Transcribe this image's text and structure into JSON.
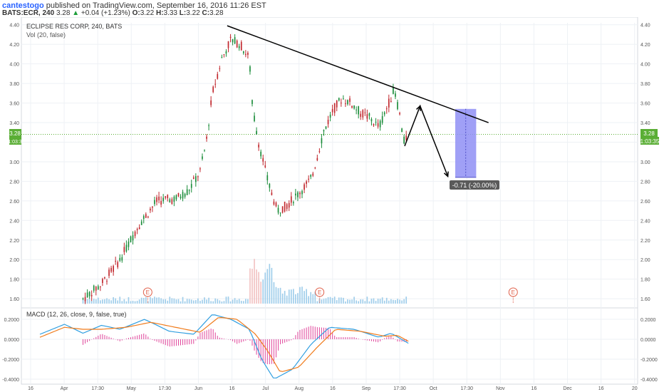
{
  "header": {
    "author": "cantestogo",
    "published_text": " published on TradingView.com, September 16, 2016 11:26 EST",
    "symbol": "BATS:ECR, 240",
    "last": "3.28",
    "change_arrow": "▲",
    "change": "+0.04 (+1.23%)",
    "o_label": "O:",
    "o_value": "3.22",
    "h_label": "H:",
    "h_value": "3.33",
    "l_label": "L:",
    "l_value": "3.22",
    "c_label": "C:",
    "c_value": "3.28"
  },
  "legend": {
    "title": "ECLIPSE RES CORP, 240, BATS",
    "volume": "Vol (20, false)",
    "macd": "MACD (12, 26, close, 9, false, true)"
  },
  "price_badge": {
    "price": "3.28",
    "countdown": "1:03:35",
    "countdown_left": "1:03:3"
  },
  "measure_label": "-0.71 (-20.00%)",
  "earnings_marker": "E",
  "colors": {
    "up": "#1b8c3a",
    "down": "#c1272d",
    "macd_line": "#2f9ee0",
    "signal_line": "#f07b1b",
    "histogram": "#e0449a",
    "volume": "#8fc6e8",
    "volume_red": "#f0b8b8",
    "measure_fill": "#8f8ff5",
    "badge": "#5aae35",
    "grid": "#eef1f5",
    "trendline": "#000000"
  },
  "chart_data": {
    "type": "candlestick",
    "price_axis_ticks": [
      "4.40",
      "4.20",
      "4.00",
      "3.80",
      "3.60",
      "3.40",
      "3.20",
      "3.00",
      "2.80",
      "2.60",
      "2.40",
      "2.20",
      "2.00",
      "1.80",
      "1.60"
    ],
    "macd_axis_ticks": [
      "0.2000",
      "0.0000",
      "-0.2000",
      "-0.4000"
    ],
    "x_tick_labels": [
      "16",
      "Apr",
      "17:30",
      "May",
      "17:30",
      "Jun",
      "16",
      "Jul",
      "Aug",
      "16",
      "Sep",
      "17:30",
      "Oct",
      "17:30",
      "Nov",
      "16",
      "Dec",
      "16",
      "20"
    ],
    "ylim": [
      1.55,
      4.42
    ],
    "macd_ylim": [
      -0.45,
      0.3
    ],
    "last_price": 3.28,
    "trendline": {
      "start": {
        "time": 0.334,
        "price": 4.39
      },
      "end": {
        "time": 0.758,
        "price": 3.4
      }
    },
    "projection_path": [
      {
        "time": 0.622,
        "price": 3.16
      },
      {
        "time": 0.647,
        "price": 3.57
      },
      {
        "time": 0.692,
        "price": 2.85
      }
    ],
    "measure_box": {
      "time_from": 0.704,
      "time_to": 0.738,
      "price_from": 3.54,
      "price_to": 2.84
    },
    "earnings_markers_time": [
      0.205,
      0.484,
      0.798
    ],
    "history_end_time": 0.628,
    "price_anchors": [
      [
        0.1,
        1.6
      ],
      [
        0.13,
        1.75
      ],
      [
        0.16,
        2.0
      ],
      [
        0.19,
        2.35
      ],
      [
        0.22,
        2.6
      ],
      [
        0.25,
        2.62
      ],
      [
        0.27,
        2.7
      ],
      [
        0.29,
        2.9
      ],
      [
        0.3,
        3.2
      ],
      [
        0.31,
        3.7
      ],
      [
        0.325,
        4.05
      ],
      [
        0.34,
        4.25
      ],
      [
        0.355,
        4.2
      ],
      [
        0.37,
        4.05
      ],
      [
        0.375,
        3.55
      ],
      [
        0.385,
        3.2
      ],
      [
        0.4,
        2.8
      ],
      [
        0.415,
        2.5
      ],
      [
        0.43,
        2.55
      ],
      [
        0.45,
        2.68
      ],
      [
        0.47,
        2.82
      ],
      [
        0.48,
        3.05
      ],
      [
        0.49,
        3.3
      ],
      [
        0.505,
        3.52
      ],
      [
        0.52,
        3.65
      ],
      [
        0.535,
        3.6
      ],
      [
        0.55,
        3.5
      ],
      [
        0.565,
        3.45
      ],
      [
        0.58,
        3.35
      ],
      [
        0.595,
        3.58
      ],
      [
        0.605,
        3.74
      ],
      [
        0.615,
        3.45
      ],
      [
        0.62,
        3.2
      ],
      [
        0.628,
        3.28
      ]
    ],
    "macd_anchors": [
      [
        0.03,
        0.05
      ],
      [
        0.07,
        0.15
      ],
      [
        0.1,
        0.06
      ],
      [
        0.13,
        0.14
      ],
      [
        0.16,
        0.1
      ],
      [
        0.2,
        0.2
      ],
      [
        0.24,
        0.08
      ],
      [
        0.28,
        0.05
      ],
      [
        0.31,
        0.25
      ],
      [
        0.34,
        0.2
      ],
      [
        0.37,
        0.1
      ],
      [
        0.39,
        -0.2
      ],
      [
        0.41,
        -0.4
      ],
      [
        0.44,
        -0.3
      ],
      [
        0.47,
        -0.05
      ],
      [
        0.5,
        0.12
      ],
      [
        0.54,
        0.1
      ],
      [
        0.58,
        0.02
      ],
      [
        0.6,
        0.06
      ],
      [
        0.628,
        -0.04
      ]
    ],
    "signal_anchors": [
      [
        0.03,
        0.02
      ],
      [
        0.07,
        0.12
      ],
      [
        0.1,
        0.1
      ],
      [
        0.13,
        0.1
      ],
      [
        0.17,
        0.12
      ],
      [
        0.21,
        0.17
      ],
      [
        0.25,
        0.12
      ],
      [
        0.29,
        0.07
      ],
      [
        0.32,
        0.22
      ],
      [
        0.35,
        0.2
      ],
      [
        0.38,
        0.05
      ],
      [
        0.4,
        -0.12
      ],
      [
        0.42,
        -0.33
      ],
      [
        0.45,
        -0.28
      ],
      [
        0.48,
        -0.08
      ],
      [
        0.51,
        0.1
      ],
      [
        0.55,
        0.08
      ],
      [
        0.59,
        0.03
      ],
      [
        0.61,
        0.04
      ],
      [
        0.628,
        -0.02
      ]
    ]
  }
}
